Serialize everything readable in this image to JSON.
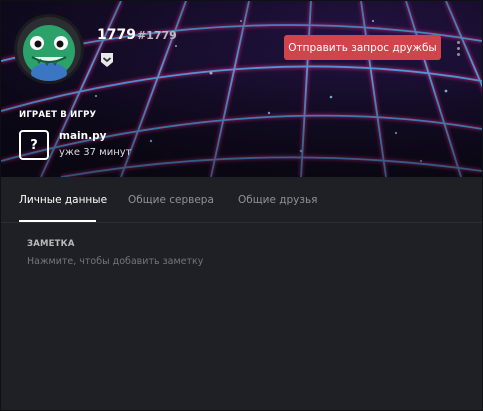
{
  "profile": {
    "username": "1779",
    "discriminator": "#1779",
    "avatar_icon": "frog-avatar-icon",
    "badge_icon": "hypesquad-badge-icon",
    "add_friend_label": "Отправить запрос дружбы",
    "more_icon": "more-vertical-icon"
  },
  "activity": {
    "header": "ИГРАЕТ В ИГРУ",
    "game_icon": "?",
    "game_name": "main.py",
    "elapsed": "уже 37 минут"
  },
  "tabs": [
    {
      "label": "Личные данные",
      "active": true
    },
    {
      "label": "Общие сервера",
      "active": false
    },
    {
      "label": "Общие друзья",
      "active": false
    }
  ],
  "note": {
    "label": "ЗАМЕТКА",
    "placeholder": "Нажмите, чтобы добавить заметку"
  },
  "colors": {
    "accent_button": "#d0454c",
    "background": "#1e2025",
    "grid_blue": "#4aa8ff",
    "grid_pink": "#ff3da8"
  }
}
